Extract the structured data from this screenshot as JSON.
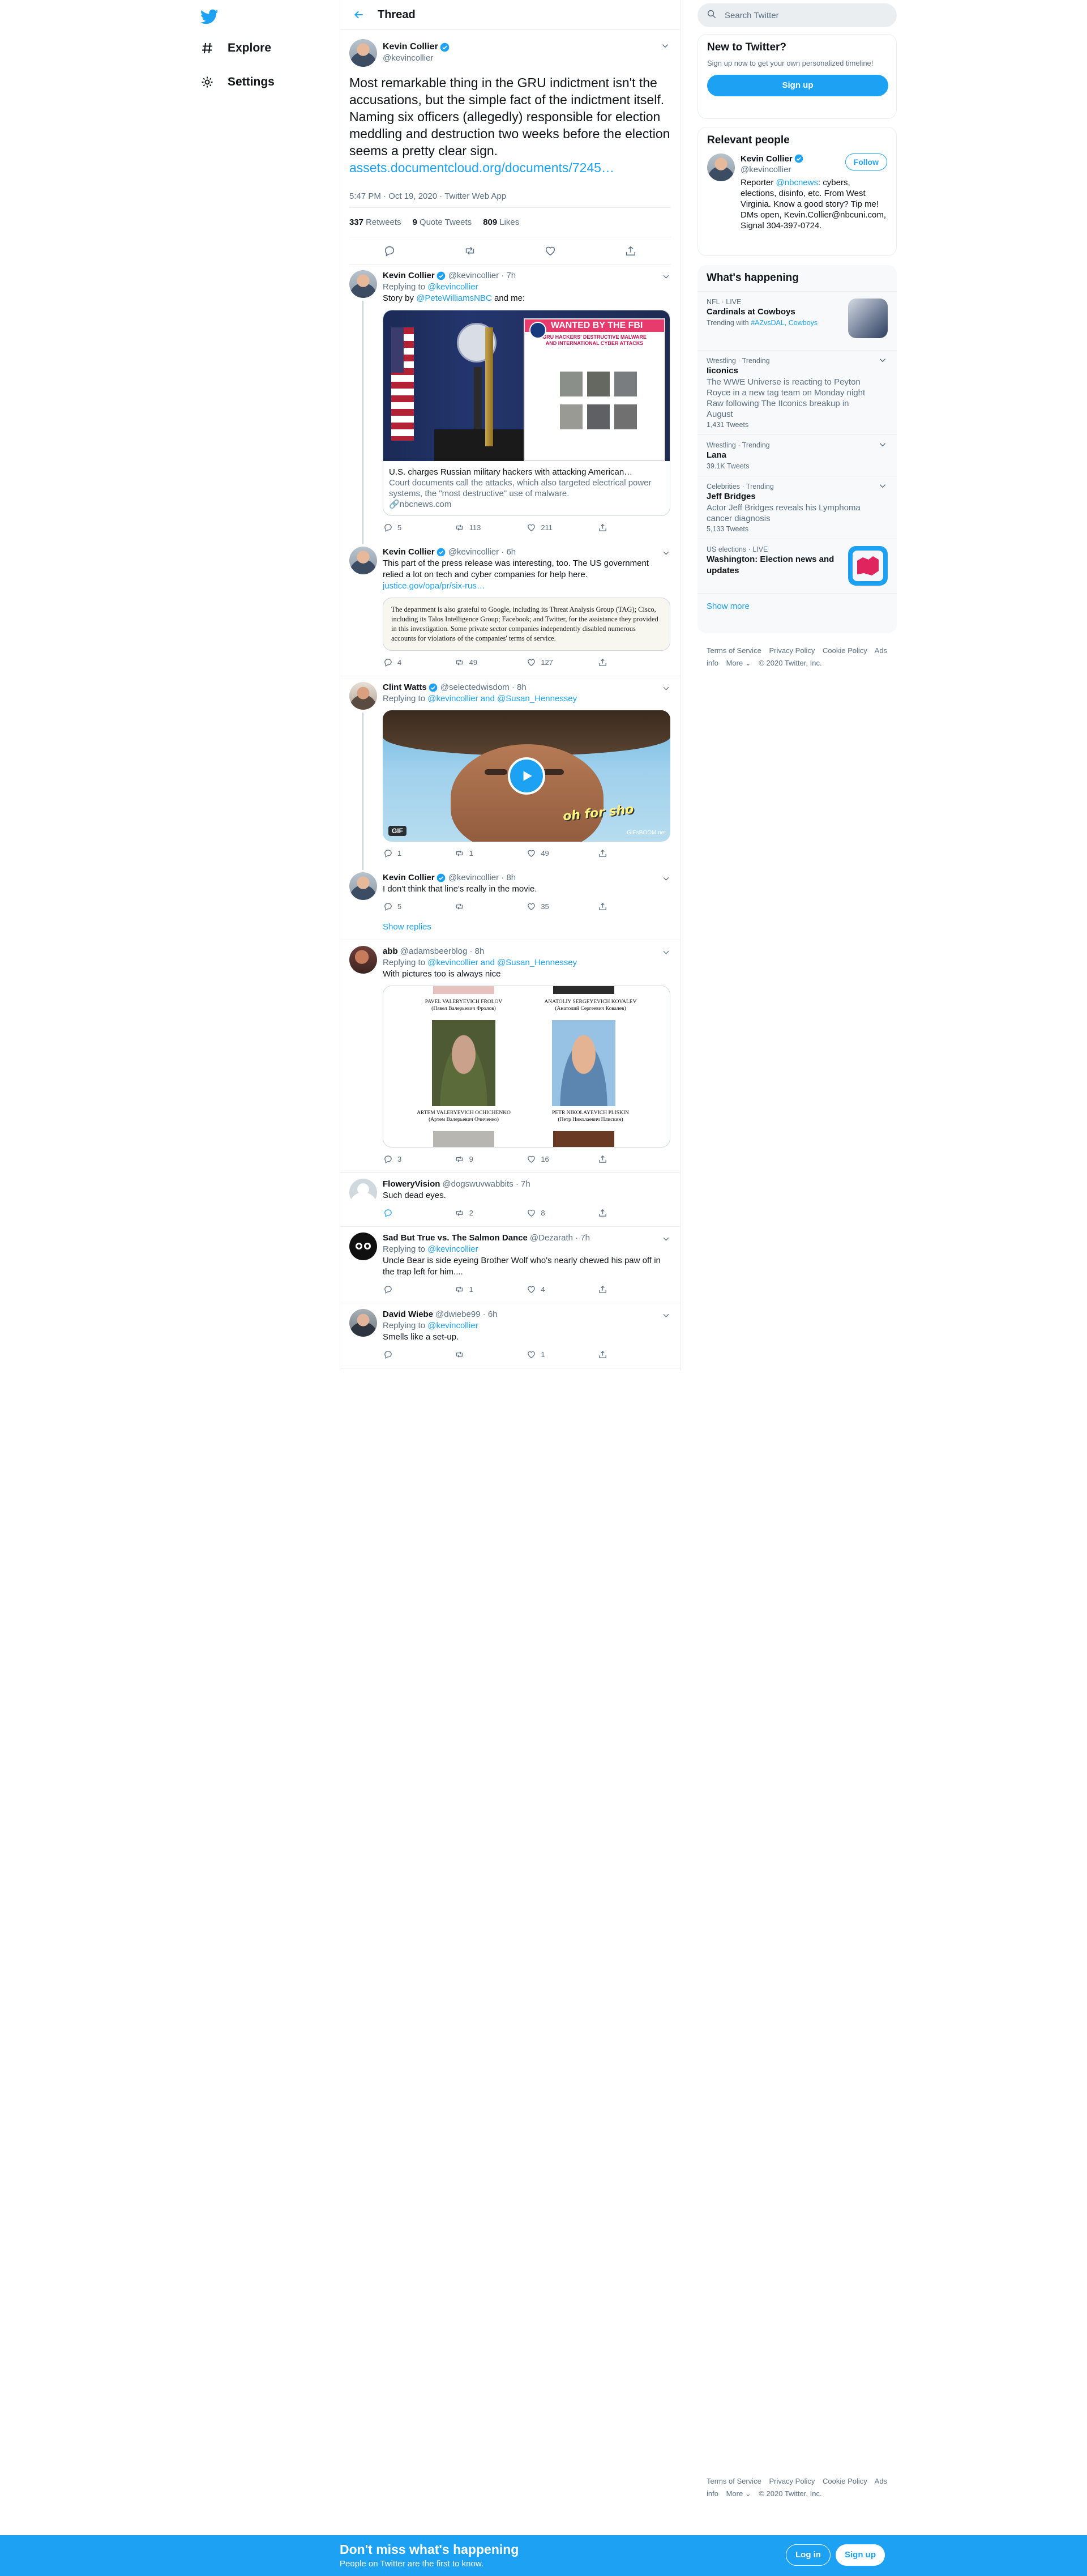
{
  "nav": {
    "explore_label": "Explore",
    "settings_label": "Settings"
  },
  "header": {
    "title": "Thread"
  },
  "main_tweet": {
    "name": "Kevin Collier",
    "handle": "@kevincollier",
    "text": "Most remarkable thing in the GRU indictment isn't the accusations, but the simple fact of the indictment itself. Naming six officers (allegedly) responsible for election meddling and destruction two weeks before the election seems a pretty clear sign.",
    "link": "assets.documentcloud.org/documents/7245…",
    "meta": "5:47 PM · Oct 19, 2020 · Twitter Web App",
    "retweets": "337",
    "retweets_label": "Retweets",
    "quotes": "9",
    "quotes_label": "Quote Tweets",
    "likes": "809",
    "likes_label": "Likes"
  },
  "replies": [
    {
      "name": "Kevin Collier",
      "handle": "@kevincollier · 7h",
      "reply_prefix": "Replying to",
      "reply_to": "@kevincollier",
      "text_before": "Story by",
      "mention": "@PeteWilliamsNBC",
      "text_after": "and me:",
      "card_title": "U.S. charges Russian military hackers with attacking American…",
      "card_desc": "Court documents call the attacks, which also targeted electrical power systems, the \"most destructive\" use of malware.",
      "card_domain": "nbcnews.com",
      "poster_title": "WANTED BY THE FBI",
      "poster_sub": "GRU HACKERS' DESTRUCTIVE MALWARE AND INTERNATIONAL CYBER ATTACKS",
      "replies": "5",
      "retweets": "113",
      "likes": "211"
    },
    {
      "name": "Kevin Collier",
      "handle": "@kevincollier · 6h",
      "text": "This part of the press release was interesting, too. The US government relied a lot on tech and cyber companies for help here.",
      "link": "justice.gov/opa/pr/six-rus…",
      "quote_text": "The department is also grateful to Google, including its Threat Analysis Group (TAG); Cisco, including its Talos Intelligence Group; Facebook; and Twitter, for the assistance they provided in this investigation.  Some private sector companies independently disabled numerous accounts for violations of the companies' terms of service.",
      "replies": "4",
      "retweets": "49",
      "likes": "127"
    },
    {
      "name": "Clint Watts",
      "handle": "@selectedwisdom · 8h",
      "reply_prefix": "Replying to",
      "reply_to": "@kevincollier and @Susan_Hennessey",
      "gif_caption": "oh for sho",
      "gif_badge": "GIF",
      "gif_watermark": "GIFsBOOM.net",
      "replies": "1",
      "retweets": "1",
      "likes": "49"
    },
    {
      "name": "Kevin Collier",
      "handle": "@kevincollier · 8h",
      "text": "I don't think that line's really in the movie.",
      "replies": "5",
      "retweets": "",
      "likes": "35",
      "show_replies": "Show replies"
    },
    {
      "name": "abb",
      "handle": "@adamsbeerblog · 8h",
      "reply_prefix": "Replying to",
      "reply_to": "@kevincollier and @Susan_Hennessey",
      "text": "With pictures too is always nice",
      "photo_names": [
        {
          "name": "PAVEL VALERYEVICH FROLOV",
          "native": "(Павел Валерьевич Фролов)"
        },
        {
          "name": "ANATOLIY SERGEYEVICH KOVALEV",
          "native": "(Анатолий Сергеевич Ковалев)"
        },
        {
          "name": "ARTEM VALERYEVICH OCHICHENKO",
          "native": "(Артем Валерьевич Очиченко)"
        },
        {
          "name": "PETR NIKOLAYEVICH PLISKIN",
          "native": "(Петр Николаевич Плискин)"
        }
      ],
      "replies": "3",
      "retweets": "9",
      "likes": "16"
    },
    {
      "name": "FloweryVision",
      "handle": "@dogswuvwabbits · 7h",
      "text": "Such dead eyes.",
      "replies": "",
      "retweets": "2",
      "likes": "8"
    },
    {
      "name": "Sad But True vs. The Salmon Dance",
      "handle": "@Dezarath · 7h",
      "reply_prefix": "Replying to",
      "reply_to": "@kevincollier",
      "text": "Uncle Bear is side eyeing  Brother Wolf who's nearly chewed his paw off in the trap left for him....",
      "replies": "",
      "retweets": "1",
      "likes": "4"
    },
    {
      "name": "David Wiebe",
      "handle": "@dwiebe99 · 6h",
      "reply_prefix": "Replying to",
      "reply_to": "@kevincollier",
      "text": "Smells like a set-up.",
      "replies": "",
      "retweets": "",
      "likes": "1"
    }
  ],
  "search": {
    "placeholder": "Search Twitter"
  },
  "new_to_twitter": {
    "title": "New to Twitter?",
    "desc": "Sign up now to get your own personalized timeline!",
    "button": "Sign up"
  },
  "relevant": {
    "title": "Relevant people",
    "name": "Kevin Collier",
    "handle": "@kevincollier",
    "follow": "Follow",
    "bio_before": "Reporter",
    "bio_mention": "@nbcnews",
    "bio_after": ": cybers, elections, disinfo, etc. From West Virginia. Know a good story? Tip me! DMs open, Kevin.Collier@nbcuni.com, Signal 304-397-0724."
  },
  "whats_happening": {
    "title": "What's happening",
    "trends": [
      {
        "category": "NFL · LIVE",
        "title": "Cardinals at Cowboys",
        "with_label": "Trending with",
        "with": "#AZvsDAL, Cowboys"
      },
      {
        "category": "Wrestling · Trending",
        "title": "Iiconics",
        "desc": "The WWE Universe is reacting to Peyton Royce in a new tag team on Monday night Raw following The IIconics breakup in August",
        "count": "1,431 Tweets"
      },
      {
        "category": "Wrestling · Trending",
        "title": "Lana",
        "count": "39.1K Tweets"
      },
      {
        "category": "Celebrities · Trending",
        "title": "Jeff Bridges",
        "desc": "Actor Jeff Bridges reveals his Lymphoma cancer diagnosis",
        "count": "5,133 Tweets"
      },
      {
        "category": "US elections · LIVE",
        "title": "Washington: Election news and updates"
      }
    ],
    "show_more": "Show more"
  },
  "footer": {
    "links": [
      "Terms of Service",
      "Privacy Policy",
      "Cookie Policy",
      "Ads info",
      "More ⌄",
      "© 2020 Twitter, Inc."
    ]
  },
  "bottom_bar": {
    "title": "Don't miss what's happening",
    "subtitle": "People on Twitter are the first to know.",
    "login": "Log in",
    "signup": "Sign up"
  },
  "colors": {
    "accent": "#1da1f2",
    "text": "#0f1419",
    "secondary": "#5b7083",
    "border": "#ebeef0"
  }
}
